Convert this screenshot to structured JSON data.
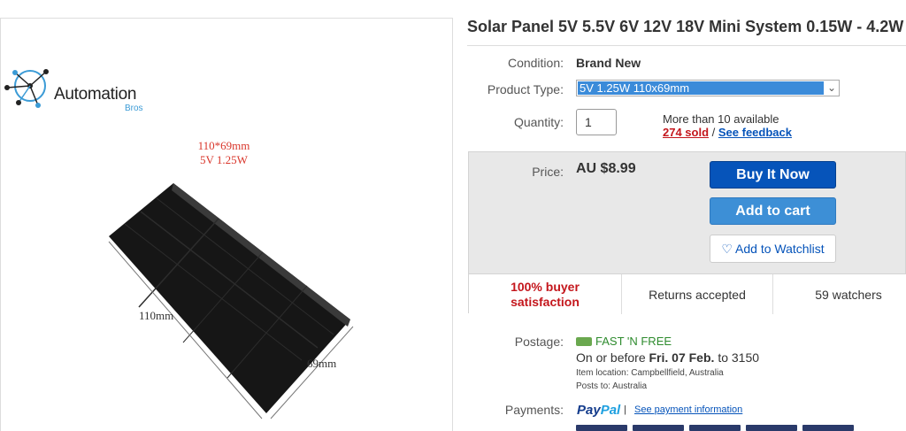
{
  "listing": {
    "title": "Solar Panel 5V 5.5V 6V 12V 18V Mini System 0.15W - 4.2W"
  },
  "image": {
    "logo_name": "Automation",
    "logo_sub": "Bros",
    "dim_size": "110*69mm",
    "dim_spec": "5V 1.25W",
    "dim_length": "110mm",
    "dim_width": "69mm"
  },
  "details": {
    "condition_label": "Condition:",
    "condition_value": "Brand New",
    "type_label": "Product Type:",
    "type_value": "5V 1.25W 110x69mm",
    "quantity_label": "Quantity:",
    "quantity_value": "1",
    "available": "More than 10 available",
    "sold": "274 sold",
    "sold_sep": " / ",
    "feedback": "See feedback"
  },
  "buy": {
    "price_label": "Price:",
    "price": "AU $8.99",
    "buy_now": "Buy It Now",
    "add_cart": "Add to cart",
    "watchlist": "Add to Watchlist"
  },
  "stats": {
    "satisfaction_line1": "100% buyer",
    "satisfaction_line2": "satisfaction",
    "returns": "Returns accepted",
    "watchers": "59 watchers"
  },
  "postage": {
    "label": "Postage:",
    "fast": "FAST 'N FREE",
    "delivery_prefix": "On or before",
    "delivery_date": "Fri. 07 Feb.",
    "delivery_suffix": "to 3150",
    "item_location": "Item location:  Campbellfield, Australia",
    "posts_to": "Posts to:  Australia"
  },
  "payments": {
    "label": "Payments:",
    "paypal_1": "Pay",
    "paypal_2": "Pal",
    "info": "See payment information",
    "bar": "|"
  },
  "colors": {
    "buy_button": "#0654ba",
    "cart_button": "#3d8fd6",
    "link": "#0654ba",
    "red": "#c4161c",
    "green": "#2e8b2e"
  },
  "icons": [
    "automation-bros-logo",
    "solar-panel-image",
    "chevron-down-icon",
    "heart-icon",
    "truck-icon",
    "paypal-logo"
  ]
}
